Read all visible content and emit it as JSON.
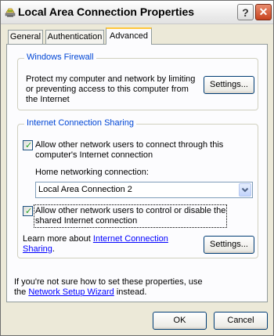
{
  "window": {
    "title": "Local Area Connection Properties",
    "help_label": "?",
    "close_label": "✕"
  },
  "tabs": [
    {
      "label": "General",
      "active": false
    },
    {
      "label": "Authentication",
      "active": false
    },
    {
      "label": "Advanced",
      "active": true
    }
  ],
  "firewall": {
    "legend": "Windows Firewall",
    "description_line1": "Protect my computer and network by limiting",
    "description_line2": "or preventing access to this computer from",
    "description_line3": "the Internet",
    "settings_label": "Settings..."
  },
  "ics": {
    "legend": "Internet Connection Sharing",
    "allow_connect_line1": "Allow other network users to connect through this",
    "allow_connect_line2": "computer's Internet connection",
    "allow_connect_checked": true,
    "home_label": "Home networking connection:",
    "home_selected": "Local Area Connection 2",
    "allow_control_line1": "Allow other network users to control or disable the",
    "allow_control_line2": "shared Internet connection",
    "allow_control_checked": true,
    "learn_more_prefix": "Learn more about ",
    "learn_more_link_line1": "Internet Connection",
    "learn_more_link_line2": "Sharing",
    "learn_more_suffix": ".",
    "settings_label": "Settings..."
  },
  "footer": {
    "line1": "If you're not sure how to set these properties, use",
    "line2_prefix": "the ",
    "wizard_link": "Network Setup Wizard",
    "line2_suffix": " instead."
  },
  "buttons": {
    "ok_label": "OK",
    "cancel_label": "Cancel"
  },
  "colors": {
    "legend_blue": "#0046d5",
    "link_blue": "#0000ff",
    "checkmark_green": "#21a121",
    "active_tab_accent": "#ffc73c"
  },
  "icons": {
    "window_icon": "network-connection-icon",
    "combo_arrow": "chevron-down-icon",
    "checkmark": "checkmark-icon"
  }
}
